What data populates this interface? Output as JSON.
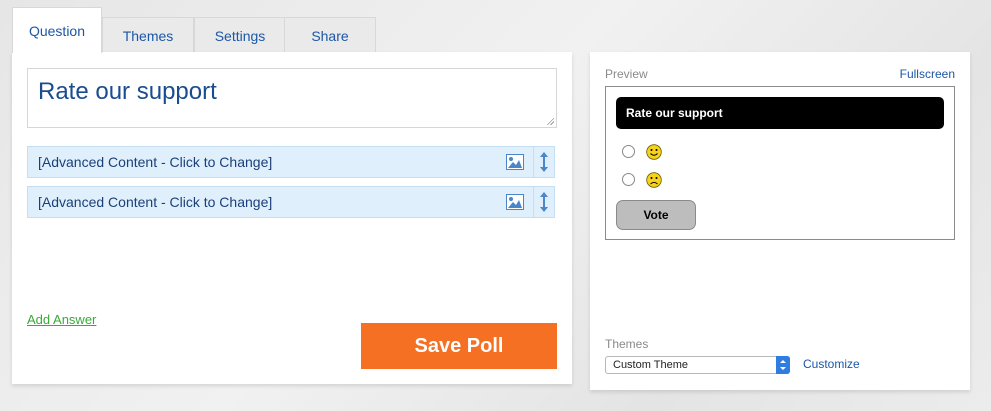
{
  "tabs": [
    {
      "label": "Question",
      "active": true
    },
    {
      "label": "Themes",
      "active": false
    },
    {
      "label": "Settings",
      "active": false
    },
    {
      "label": "Share",
      "active": false
    }
  ],
  "editor": {
    "question_value": "Rate our support",
    "answers": [
      {
        "label": "[Advanced Content - Click to Change]",
        "icons": [
          "image-icon",
          "drag-handle-icon"
        ]
      },
      {
        "label": "[Advanced Content - Click to Change]",
        "icons": [
          "image-icon",
          "drag-handle-icon"
        ]
      }
    ],
    "add_answer_label": "Add Answer",
    "save_label": "Save Poll"
  },
  "preview": {
    "label": "Preview",
    "fullscreen_label": "Fullscreen",
    "poll_title": "Rate our support",
    "options": [
      {
        "icon": "smiley-happy-icon"
      },
      {
        "icon": "smiley-sad-icon"
      }
    ],
    "vote_label": "Vote"
  },
  "themes": {
    "label": "Themes",
    "selected": "Custom Theme",
    "customize_label": "Customize"
  },
  "colors": {
    "accent_blue": "#1b57a6",
    "save_orange": "#f57022",
    "answer_bg": "#dff0fc",
    "add_answer_green": "#3aa83a"
  }
}
